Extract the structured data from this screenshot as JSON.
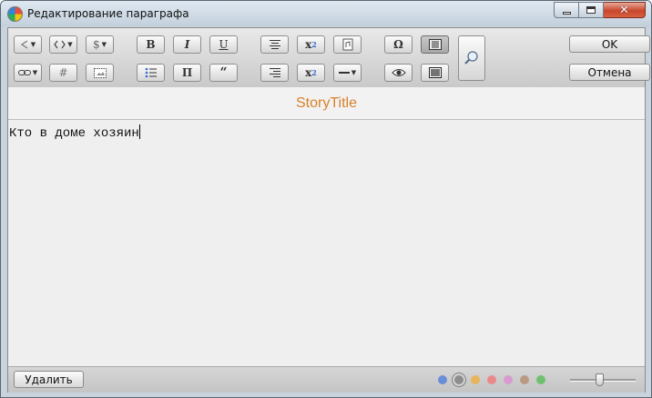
{
  "window": {
    "title": "Редактирование параграфа",
    "icon": "app-logo-icon",
    "controls": [
      "minimize-icon",
      "maximize-icon",
      "close-icon"
    ]
  },
  "toolbar": {
    "bold": "B",
    "italic": "I",
    "underline": "U",
    "superscript": "x",
    "superscript_mark": "2",
    "subscript": "x",
    "subscript_mark": "2",
    "omega": "Ω",
    "hash": "#",
    "pi": "П",
    "quote": "“",
    "dollar": "$",
    "ok_label": "OK",
    "cancel_label": "Отмена",
    "active_tool": "text-block-view"
  },
  "story": {
    "title": "StoryTitle",
    "title_color": "#d7822a"
  },
  "editor": {
    "text": "Кто в доме хозяин"
  },
  "statusbar": {
    "delete_label": "Удалить",
    "color_tags": [
      "#6b8fd6",
      "#8d8d8d",
      "#e8b45c",
      "#e98a8a",
      "#d89ad0",
      "#bb9a85",
      "#6fc06f"
    ],
    "selected_color_index": 1,
    "zoom_fraction": 0.45
  }
}
